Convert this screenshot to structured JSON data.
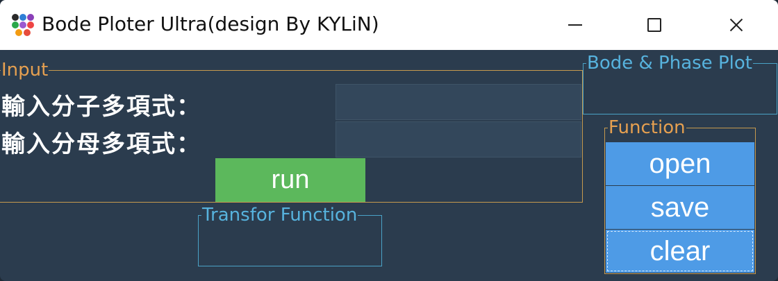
{
  "window": {
    "title": "Bode Ploter Ultra(design By KYLiN)",
    "icon": "app-dots-icon",
    "controls": {
      "minimize": "minimize-icon",
      "maximize": "maximize-icon",
      "close": "close-icon"
    }
  },
  "input": {
    "legend": "Input",
    "numerator_label": "輸入分子多項式：",
    "numerator_value": "",
    "denominator_label": "輸入分母多項式：",
    "denominator_value": "",
    "run_label": "run"
  },
  "bode": {
    "legend": "Bode & Phase Plot"
  },
  "transfer": {
    "legend": "Transfor Function"
  },
  "function": {
    "legend": "Function",
    "buttons": [
      "open",
      "save",
      "clear"
    ]
  },
  "colors": {
    "panel_bg": "#2b3c4e",
    "orange_border": "#c79a4e",
    "blue_border": "#4aa3c7",
    "run_green": "#5cb85c",
    "func_blue": "#4e9be6"
  }
}
